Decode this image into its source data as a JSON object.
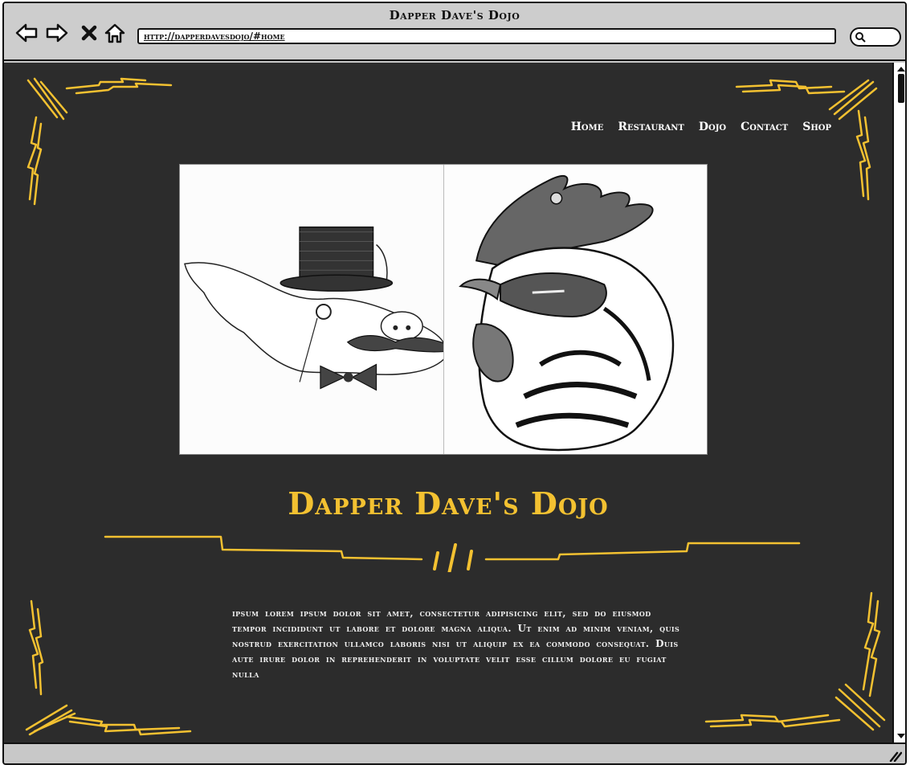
{
  "window": {
    "title": "Dapper Dave's Dojo",
    "url": "http://dapperdavesdojo/#home"
  },
  "nav": {
    "items": [
      {
        "label": "Home"
      },
      {
        "label": "Restaurant"
      },
      {
        "label": "Dojo"
      },
      {
        "label": "Contact"
      },
      {
        "label": "Shop"
      }
    ]
  },
  "hero": {
    "left_image": "dapper-pig-illustration",
    "right_image": "rooster-head-illustration"
  },
  "site_title": "Dapper Dave's Dojo",
  "body_text": "ipsum lorem ipsum dolor sit amet, consectetur adipisicing elit, sed do eiusmod tempor incididunt ut labore et dolore magna aliqua. Ut enim ad minim veniam, quis nostrud exercitation ullamco laboris nisi ut aliquip ex ea commodo consequat. Duis aute irure dolor in reprehenderit in voluptate velit esse cillum dolore eu fugiat nulla",
  "colors": {
    "background": "#2c2c2c",
    "accent": "#f3c131",
    "text": "#f0f0f0"
  },
  "icons": [
    "back-arrow-icon",
    "forward-arrow-icon",
    "stop-icon",
    "home-icon",
    "search-icon",
    "resize-grip-icon"
  ]
}
